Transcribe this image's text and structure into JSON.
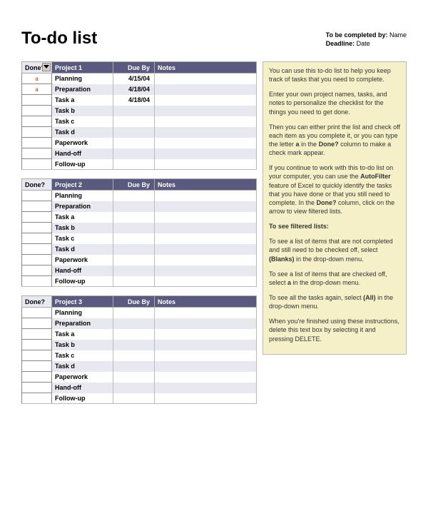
{
  "title": "To-do list",
  "meta": {
    "completed_label": "To be completed by:",
    "completed_value": "Name",
    "deadline_label": "Deadline:",
    "deadline_value": "Date"
  },
  "columns": {
    "done": "Done?",
    "due": "Due By",
    "notes": "Notes"
  },
  "projects": [
    {
      "name": "Project 1",
      "has_filter": true,
      "rows": [
        {
          "done": "a",
          "task": "Planning",
          "due": "4/15/04",
          "notes": ""
        },
        {
          "done": "a",
          "task": "Preparation",
          "due": "4/18/04",
          "notes": ""
        },
        {
          "done": "",
          "task": "Task a",
          "due": "4/18/04",
          "notes": ""
        },
        {
          "done": "",
          "task": "Task b",
          "due": "",
          "notes": ""
        },
        {
          "done": "",
          "task": "Task c",
          "due": "",
          "notes": ""
        },
        {
          "done": "",
          "task": "Task d",
          "due": "",
          "notes": ""
        },
        {
          "done": "",
          "task": "Paperwork",
          "due": "",
          "notes": ""
        },
        {
          "done": "",
          "task": "Hand-off",
          "due": "",
          "notes": ""
        },
        {
          "done": "",
          "task": "Follow-up",
          "due": "",
          "notes": ""
        }
      ]
    },
    {
      "name": "Project 2",
      "has_filter": false,
      "rows": [
        {
          "done": "",
          "task": "Planning",
          "due": "",
          "notes": ""
        },
        {
          "done": "",
          "task": "Preparation",
          "due": "",
          "notes": ""
        },
        {
          "done": "",
          "task": "Task a",
          "due": "",
          "notes": ""
        },
        {
          "done": "",
          "task": "Task b",
          "due": "",
          "notes": ""
        },
        {
          "done": "",
          "task": "Task c",
          "due": "",
          "notes": ""
        },
        {
          "done": "",
          "task": "Task d",
          "due": "",
          "notes": ""
        },
        {
          "done": "",
          "task": "Paperwork",
          "due": "",
          "notes": ""
        },
        {
          "done": "",
          "task": "Hand-off",
          "due": "",
          "notes": ""
        },
        {
          "done": "",
          "task": "Follow-up",
          "due": "",
          "notes": ""
        }
      ]
    },
    {
      "name": "Project 3",
      "has_filter": false,
      "rows": [
        {
          "done": "",
          "task": "Planning",
          "due": "",
          "notes": ""
        },
        {
          "done": "",
          "task": "Preparation",
          "due": "",
          "notes": ""
        },
        {
          "done": "",
          "task": "Task a",
          "due": "",
          "notes": ""
        },
        {
          "done": "",
          "task": "Task b",
          "due": "",
          "notes": ""
        },
        {
          "done": "",
          "task": "Task c",
          "due": "",
          "notes": ""
        },
        {
          "done": "",
          "task": "Task d",
          "due": "",
          "notes": ""
        },
        {
          "done": "",
          "task": "Paperwork",
          "due": "",
          "notes": ""
        },
        {
          "done": "",
          "task": "Hand-off",
          "due": "",
          "notes": ""
        },
        {
          "done": "",
          "task": "Follow-up",
          "due": "",
          "notes": ""
        }
      ]
    }
  ],
  "instructions": [
    [
      {
        "t": "You can use this to-do list to help you keep track of tasks that you need to complete."
      }
    ],
    [
      {
        "t": "Enter your own project names, tasks, and notes to personalize the checklist for the things you need to get done."
      }
    ],
    [
      {
        "t": "Then you can either print the list and check off each item as you complete it, or you can type the letter "
      },
      {
        "t": "a",
        "b": true
      },
      {
        "t": " in the "
      },
      {
        "t": "Done?",
        "b": true
      },
      {
        "t": " column to make a check mark appear."
      }
    ],
    [
      {
        "t": "If you continue to work with this to-do list on your computer, you can use the "
      },
      {
        "t": "AutoFilter",
        "b": true
      },
      {
        "t": " feature of Excel to quickly identify the tasks that you have done or that you still need to complete. In the "
      },
      {
        "t": "Done?",
        "b": true
      },
      {
        "t": " column, click on the arrow to view filtered lists."
      }
    ],
    [
      {
        "t": "To see filtered lists:",
        "b": true
      }
    ],
    [
      {
        "t": "To see a list of items that are not completed and still need to be checked off, select "
      },
      {
        "t": "(Blanks)",
        "b": true
      },
      {
        "t": " in the drop-down menu."
      }
    ],
    [
      {
        "t": "To see a list of items that are checked off, select "
      },
      {
        "t": "a",
        "b": true
      },
      {
        "t": " in the drop-down menu."
      }
    ],
    [
      {
        "t": "To see all the tasks again, select "
      },
      {
        "t": "(All)",
        "b": true
      },
      {
        "t": " in the drop-down menu."
      }
    ],
    [
      {
        "t": "When you're finished using these instructions, delete this text box by selecting it and pressing DELETE."
      }
    ]
  ]
}
